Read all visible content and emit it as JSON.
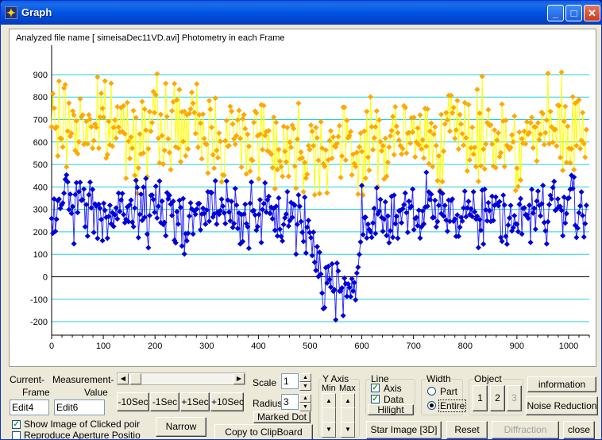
{
  "window": {
    "title": "Graph",
    "min": "_",
    "max": "□",
    "close": "✕"
  },
  "plot": {
    "header": "Analyzed file name [ simeisaDec11VD.avi]   Photometry in each Frame"
  },
  "chart_data": {
    "type": "scatter",
    "title": "",
    "xlabel": "",
    "ylabel": "",
    "xlim": [
      0,
      1040
    ],
    "ylim": [
      -260,
      960
    ],
    "xticks": [
      0,
      100,
      200,
      300,
      400,
      500,
      600,
      700,
      800,
      900,
      1000
    ],
    "yticks": [
      900,
      800,
      700,
      600,
      500,
      400,
      300,
      200,
      100,
      0,
      -100,
      -200
    ],
    "grid": "horizontal",
    "series": [
      {
        "color": "#ffa800",
        "line_color": "#ffff00",
        "segments": [
          [
            0,
            680
          ],
          [
            60,
            680
          ],
          [
            120,
            670
          ],
          [
            180,
            640
          ],
          [
            240,
            680
          ],
          [
            300,
            650
          ],
          [
            360,
            610
          ],
          [
            400,
            640
          ],
          [
            460,
            560
          ],
          [
            500,
            590
          ],
          [
            540,
            580
          ],
          [
            580,
            555
          ],
          [
            600,
            570
          ],
          [
            650,
            610
          ],
          [
            700,
            610
          ],
          [
            760,
            640
          ],
          [
            810,
            630
          ],
          [
            860,
            640
          ],
          [
            900,
            600
          ],
          [
            960,
            650
          ],
          [
            1040,
            620
          ]
        ],
        "spread": 140
      },
      {
        "color": "#0000d8",
        "line_color": "#3030ff",
        "segments": [
          [
            0,
            280
          ],
          [
            60,
            330
          ],
          [
            120,
            260
          ],
          [
            180,
            310
          ],
          [
            240,
            270
          ],
          [
            300,
            290
          ],
          [
            360,
            290
          ],
          [
            400,
            260
          ],
          [
            460,
            270
          ],
          [
            500,
            200
          ],
          [
            520,
            20
          ],
          [
            545,
            -50
          ],
          [
            570,
            -30
          ],
          [
            595,
            20
          ],
          [
            600,
            260
          ],
          [
            650,
            270
          ],
          [
            700,
            260
          ],
          [
            760,
            300
          ],
          [
            800,
            300
          ],
          [
            850,
            280
          ],
          [
            900,
            260
          ],
          [
            960,
            310
          ],
          [
            1040,
            300
          ]
        ],
        "spread": 100
      }
    ]
  },
  "controls": {
    "current_frame_label_1": "Current-",
    "current_frame_label_2": "Frame",
    "measurement_label_1": "Measurement-",
    "measurement_label_2": "Value",
    "edit4": "Edit4",
    "edit6": "Edit6",
    "minus10": "-10Sec",
    "minus1": "-1Sec",
    "plus1": "+1Sec",
    "plus10": "+10Sec",
    "show_image": "Show Image of Clicked poir",
    "reproduce": "Reproduce Aperture Positio",
    "narrow": "Narrow",
    "scale_label": "Scale",
    "scale_value": "1",
    "radius_label": "Radius",
    "radius_value": "3",
    "marked_dot": "Marked Dot",
    "copy": "Copy to ClipBoard",
    "y_axis_title": "Y Axis",
    "min_label": "Min",
    "max_label": "Max",
    "line_title": "Line",
    "axis_label": "Axis",
    "data_label": "Data",
    "hilight": "Hilight",
    "width_title": "Width",
    "part": "Part",
    "entire": "Entire",
    "object_title": "Object",
    "obj1": "1",
    "obj2": "2",
    "obj3": "3",
    "information": "information",
    "noise": "Noise Reduction",
    "star_image": "Star Image [3D]",
    "reset": "Reset",
    "diffraction": "Diffraction",
    "close": "close"
  }
}
